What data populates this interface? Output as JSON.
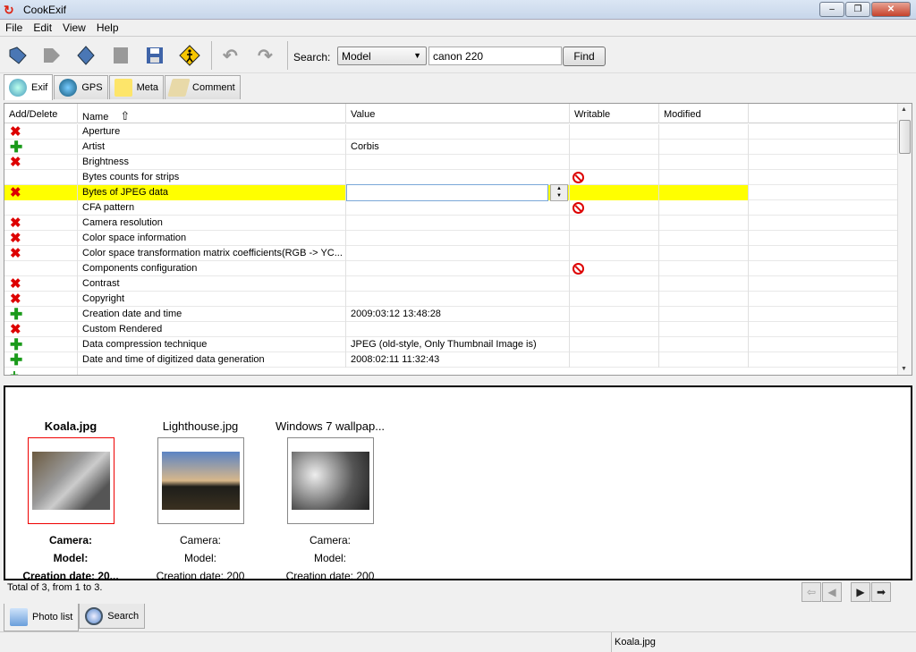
{
  "window": {
    "title": "CookExif"
  },
  "menu": [
    "File",
    "Edit",
    "View",
    "Help"
  ],
  "toolbar": {
    "search_label": "Search:",
    "search_field": "Model",
    "search_value": "canon 220",
    "find_label": "Find"
  },
  "tabs": [
    {
      "label": "Exif",
      "active": true
    },
    {
      "label": "GPS"
    },
    {
      "label": "Meta"
    },
    {
      "label": "Comment"
    }
  ],
  "table": {
    "columns": [
      "Add/Delete",
      "Name",
      "Value",
      "Writable",
      "Modified"
    ],
    "rows": [
      {
        "action": "delete",
        "name": "Aperture",
        "value": ""
      },
      {
        "action": "add",
        "name": "Artist",
        "value": "Corbis"
      },
      {
        "action": "delete",
        "name": "Brightness",
        "value": ""
      },
      {
        "action": "",
        "name": "Bytes counts for strips",
        "value": "",
        "writable": "not-writable"
      },
      {
        "action": "delete",
        "name": "Bytes of JPEG data",
        "value": "",
        "selected": true
      },
      {
        "action": "",
        "name": "CFA pattern",
        "value": "",
        "writable": "not-writable"
      },
      {
        "action": "delete",
        "name": "Camera resolution",
        "value": ""
      },
      {
        "action": "delete",
        "name": "Color space information",
        "value": ""
      },
      {
        "action": "delete",
        "name": "Color space transformation matrix coefficients(RGB -> YC...",
        "value": ""
      },
      {
        "action": "",
        "name": "Components configuration",
        "value": "",
        "writable": "not-writable"
      },
      {
        "action": "delete",
        "name": "Contrast",
        "value": ""
      },
      {
        "action": "delete",
        "name": "Copyright",
        "value": ""
      },
      {
        "action": "add",
        "name": "Creation date and time",
        "value": "2009:03:12 13:48:28"
      },
      {
        "action": "delete",
        "name": "Custom Rendered",
        "value": ""
      },
      {
        "action": "add",
        "name": "Data compression technique",
        "value": "JPEG (old-style, Only Thumbnail Image is)"
      },
      {
        "action": "add",
        "name": "Date and time of digitized data generation",
        "value": "2008:02:11 11:32:43"
      }
    ]
  },
  "photos": [
    {
      "name": "Koala.jpg",
      "camera": "Camera:",
      "model": "Model:",
      "date": "Creation date: 20...",
      "selected": true
    },
    {
      "name": "Lighthouse.jpg",
      "camera": "Camera:",
      "model": "Model:",
      "date": "Creation date: 200"
    },
    {
      "name": "Windows 7 wallpap...",
      "camera": "Camera:",
      "model": "Model:",
      "date": "Creation date: 200"
    }
  ],
  "total": "Total of 3, from 1 to 3.",
  "bottom_tabs": [
    {
      "label": "Photo list",
      "active": true
    },
    {
      "label": "Search"
    }
  ],
  "status": {
    "file": "Koala.jpg"
  }
}
